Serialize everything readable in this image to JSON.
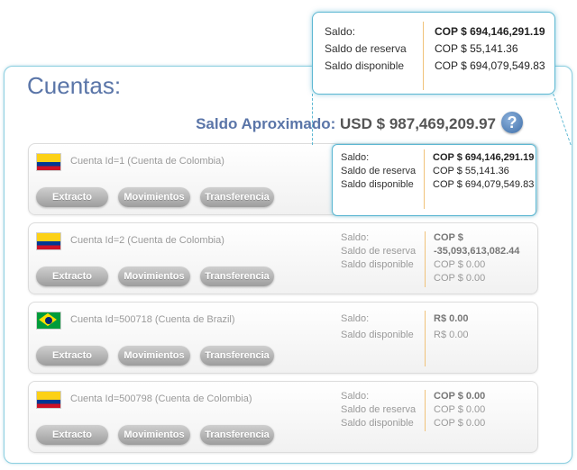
{
  "page": {
    "title": "Cuentas:",
    "total_label": "Saldo Aproximado:",
    "total_value": "USD $ 987,469,209.97",
    "help_icon": "?"
  },
  "labels": {
    "saldo": "Saldo:",
    "reserva": "Saldo de reserva",
    "disponible": "Saldo disponible"
  },
  "buttons": {
    "extracto": "Extracto",
    "movimientos": "Movimientos",
    "transferencia": "Transferencia"
  },
  "tooltip": {
    "saldo": "COP $ 694,146,291.19",
    "reserva": "COP $ 55,141.36",
    "disponible": "COP $ 694,079,549.83"
  },
  "accounts": [
    {
      "flag": "flag-colombia",
      "name": "Cuenta Id=1  (Cuenta de Colombia)",
      "saldo": "COP $ 694,146,291.19",
      "reserva": "COP $ 55,141.36",
      "disponible": "COP $ 694,079,549.83"
    },
    {
      "flag": "flag-colombia",
      "name": "Cuenta Id=2  (Cuenta de Colombia)",
      "saldo_line1": "COP $",
      "saldo_line2": "-35,093,613,082.44",
      "reserva": "COP $ 0.00",
      "disponible": "COP $ 0.00"
    },
    {
      "flag": "flag-brazil",
      "name": "Cuenta Id=500718  (Cuenta de Brazil)",
      "saldo": "R$ 0.00",
      "disponible": "R$ 0.00"
    },
    {
      "flag": "flag-colombia",
      "name": "Cuenta Id=500798  (Cuenta de Colombia)",
      "saldo": "COP $ 0.00",
      "reserva": "COP $ 0.00",
      "disponible": "COP $ 0.00"
    }
  ]
}
